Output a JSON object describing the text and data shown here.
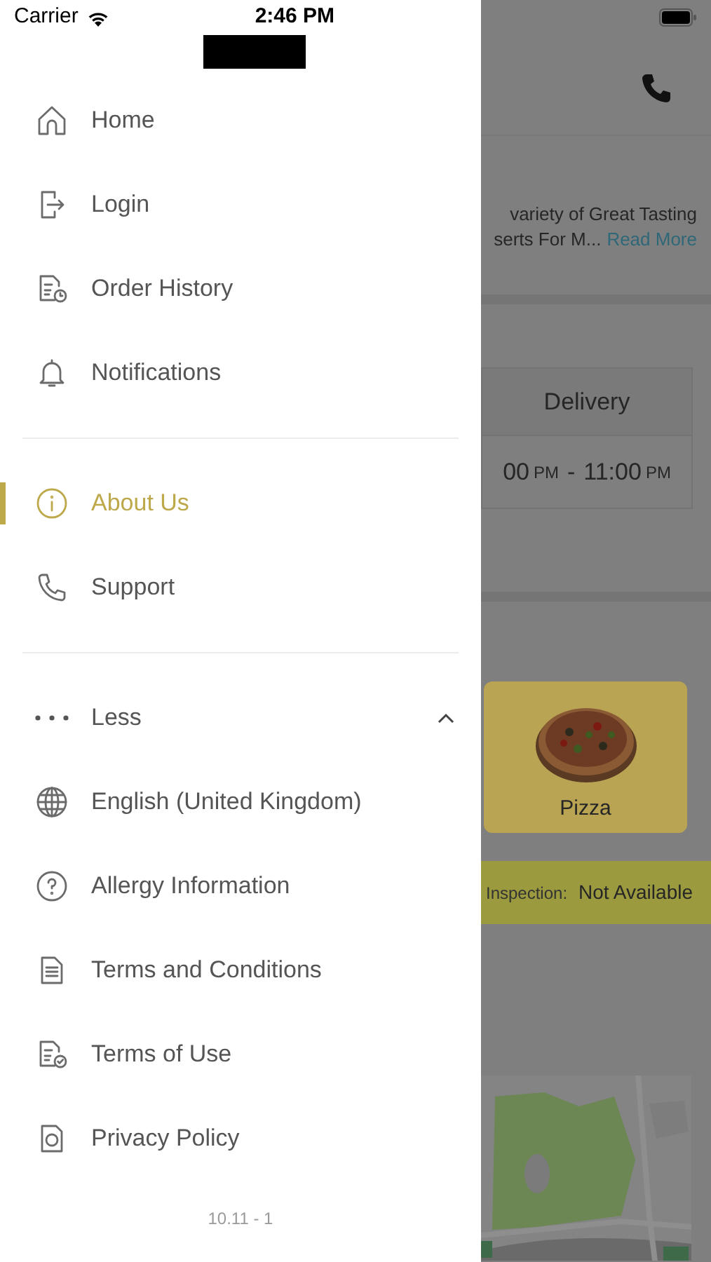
{
  "status_bar": {
    "carrier": "Carrier",
    "time": "2:46 PM"
  },
  "drawer": {
    "main_items": [
      {
        "label": "Home",
        "selected": false
      },
      {
        "label": "Login",
        "selected": false
      },
      {
        "label": "Order History",
        "selected": false
      },
      {
        "label": "Notifications",
        "selected": false
      }
    ],
    "info_items": [
      {
        "label": "About Us",
        "selected": true
      },
      {
        "label": "Support",
        "selected": false
      }
    ],
    "more_toggle": {
      "label": "Less",
      "expanded": true
    },
    "more_items": [
      {
        "label": "English (United Kingdom)",
        "selected": false
      },
      {
        "label": "Allergy Information",
        "selected": false
      },
      {
        "label": "Terms and Conditions",
        "selected": false
      },
      {
        "label": "Terms of Use",
        "selected": false
      },
      {
        "label": "Privacy Policy",
        "selected": false
      }
    ],
    "version": "10.11 - 1"
  },
  "background_page": {
    "description": [
      "variety of Great Tasting",
      "serts For M..."
    ],
    "read_more": "Read More",
    "hours_table": {
      "header": "Delivery",
      "start": "00",
      "start_suffix": "PM",
      "separator": "-",
      "end": "11:00",
      "end_suffix": "PM"
    },
    "category_card": {
      "label": "Pizza",
      "kind": "picture"
    },
    "inspection": {
      "label": "Inspection:",
      "value": "Not Available"
    }
  }
}
